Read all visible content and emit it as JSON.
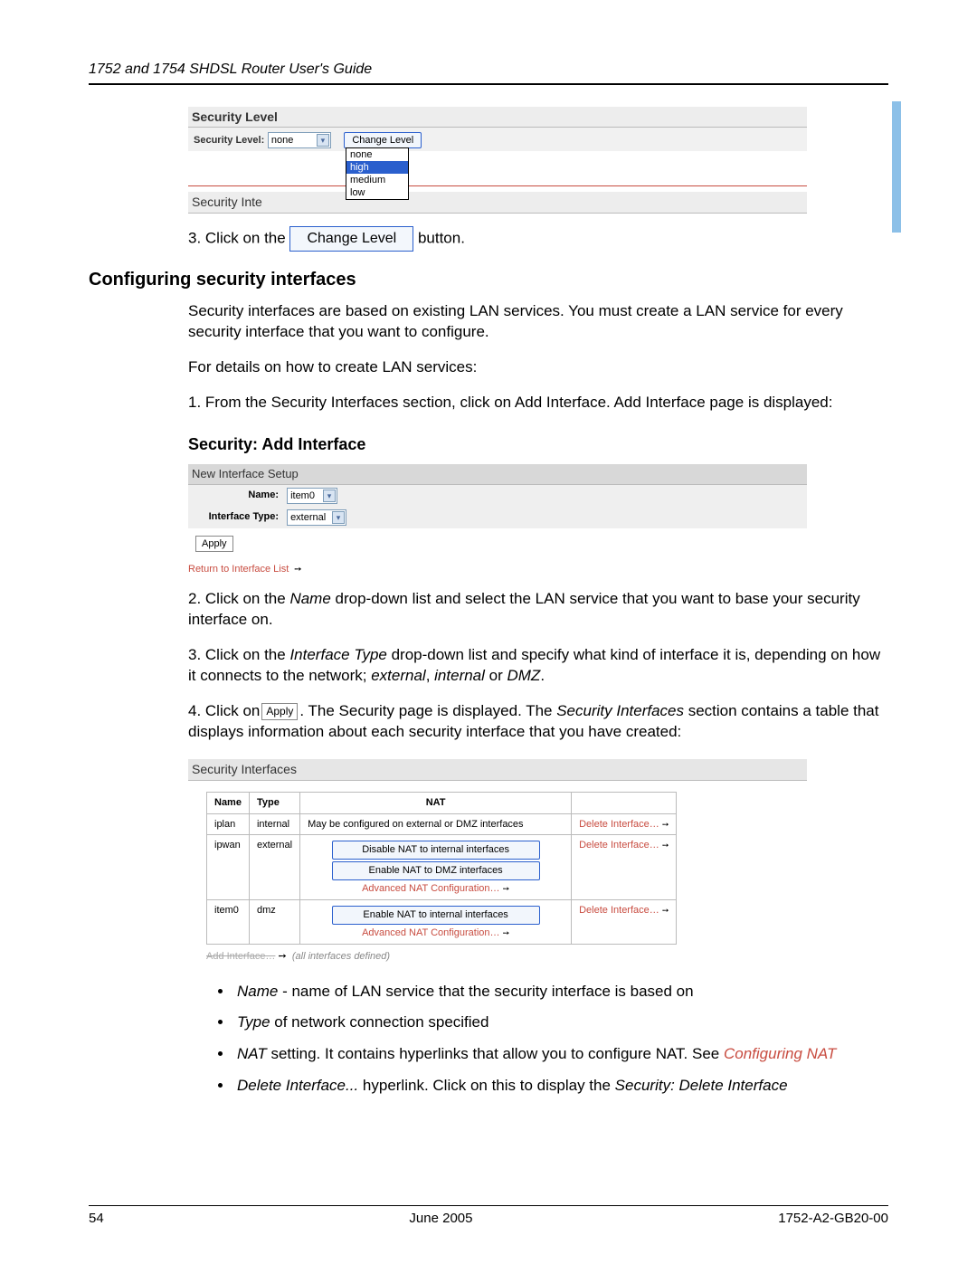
{
  "header": {
    "title": "1752 and 1754 SHDSL Router User's Guide"
  },
  "security_level_panel": {
    "title": "Security Level",
    "label": "Security Level:",
    "selected": "none",
    "options": [
      "none",
      "high",
      "medium",
      "low"
    ],
    "highlighted_option": "high",
    "change_button": "Change Level",
    "interfaces_title": "Security Inte"
  },
  "step3": {
    "prefix": "3. Click on the ",
    "button_label": "Change Level",
    "suffix": " button."
  },
  "section_config": {
    "heading": "Configuring security interfaces",
    "p1": "Security interfaces are based on existing LAN services. You must create a LAN service for every security interface that you want to configure.",
    "p2": "For details on how to create LAN services:",
    "p3": "1. From the Security Interfaces section, click on Add Interface. Add Interface page is displayed:"
  },
  "add_interface_panel": {
    "title": "Security: Add Interface",
    "setup_header": "New Interface Setup",
    "name_label": "Name:",
    "name_value": "item0",
    "type_label": "Interface Type:",
    "type_value": "external",
    "apply_label": "Apply",
    "return_link": "Return to Interface List"
  },
  "after_add": {
    "p2a": "2. Click on the ",
    "p2b": " drop-down list and select the LAN service that you want to base your security interface on.",
    "p2_name": "Name",
    "p3a": "3. Click on the ",
    "p3_iftype": "Interface Type",
    "p3b": " drop-down list and specify what kind of interface it is, depending on how it connects to the network; ",
    "p3_ext": "external",
    "p3_or1": ", ",
    "p3_int": "internal",
    "p3_or2": " or ",
    "p3_dmz": "DMZ",
    "p3_end": ".",
    "p4a": "4. Click on",
    "p4_apply": "Apply",
    "p4b": ". The Security page is displayed. The ",
    "p4_si": "Security Interfaces",
    "p4c": " section contains a table that displays information about each security interface that you have created:"
  },
  "si_table": {
    "title": "Security Interfaces",
    "headers": [
      "Name",
      "Type",
      "NAT",
      ""
    ],
    "rows": [
      {
        "name": "iplan",
        "type": "internal",
        "nat_text": "May be configured on external or DMZ interfaces",
        "nat_buttons": [],
        "adv_nat": false,
        "delete": "Delete Interface…"
      },
      {
        "name": "ipwan",
        "type": "external",
        "nat_text": "",
        "nat_buttons": [
          "Disable NAT to internal interfaces",
          "Enable NAT to DMZ interfaces"
        ],
        "adv_nat": true,
        "adv_nat_label": "Advanced NAT Configuration…",
        "delete": "Delete Interface…"
      },
      {
        "name": "item0",
        "type": "dmz",
        "nat_text": "",
        "nat_buttons": [
          "Enable NAT to internal interfaces"
        ],
        "adv_nat": true,
        "adv_nat_label": "Advanced NAT Configuration…",
        "delete": "Delete Interface…"
      }
    ],
    "footer_strike": "Add Interface…",
    "footer_note": "(all interfaces defined)"
  },
  "bullets": {
    "b1a": "Name",
    "b1b": " - name of LAN service that the security interface is based on",
    "b2a": "Type",
    "b2b": " of network connection specified",
    "b3a": "NAT",
    "b3b": " setting. It contains hyperlinks that allow you to configure NAT. See ",
    "b3link": "Configuring NAT",
    "b4a": "Delete Interface...",
    "b4b": " hyperlink. Click on this to display the ",
    "b4c": "Security: Delete Interface"
  },
  "footer": {
    "page": "54",
    "date": "June 2005",
    "docid": "1752-A2-GB20-00"
  }
}
